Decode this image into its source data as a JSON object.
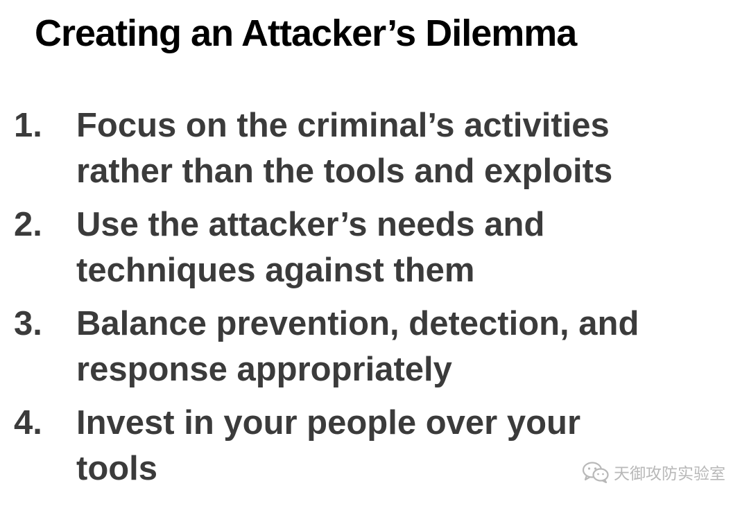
{
  "title": "Creating an Attacker’s Dilemma",
  "points": [
    {
      "num": "1.",
      "lines": [
        "Focus on the criminal’s activities",
        "rather than the tools and exploits"
      ]
    },
    {
      "num": "2.",
      "lines": [
        "Use the attacker’s needs and",
        "techniques against them"
      ]
    },
    {
      "num": "3.",
      "lines": [
        "Balance prevention, detection, and",
        "response appropriately"
      ]
    },
    {
      "num": "4.",
      "lines": [
        "Invest in your people over your",
        "tools"
      ]
    }
  ],
  "watermark": {
    "icon": "wechat-icon",
    "text": "天御攻防实验室"
  }
}
